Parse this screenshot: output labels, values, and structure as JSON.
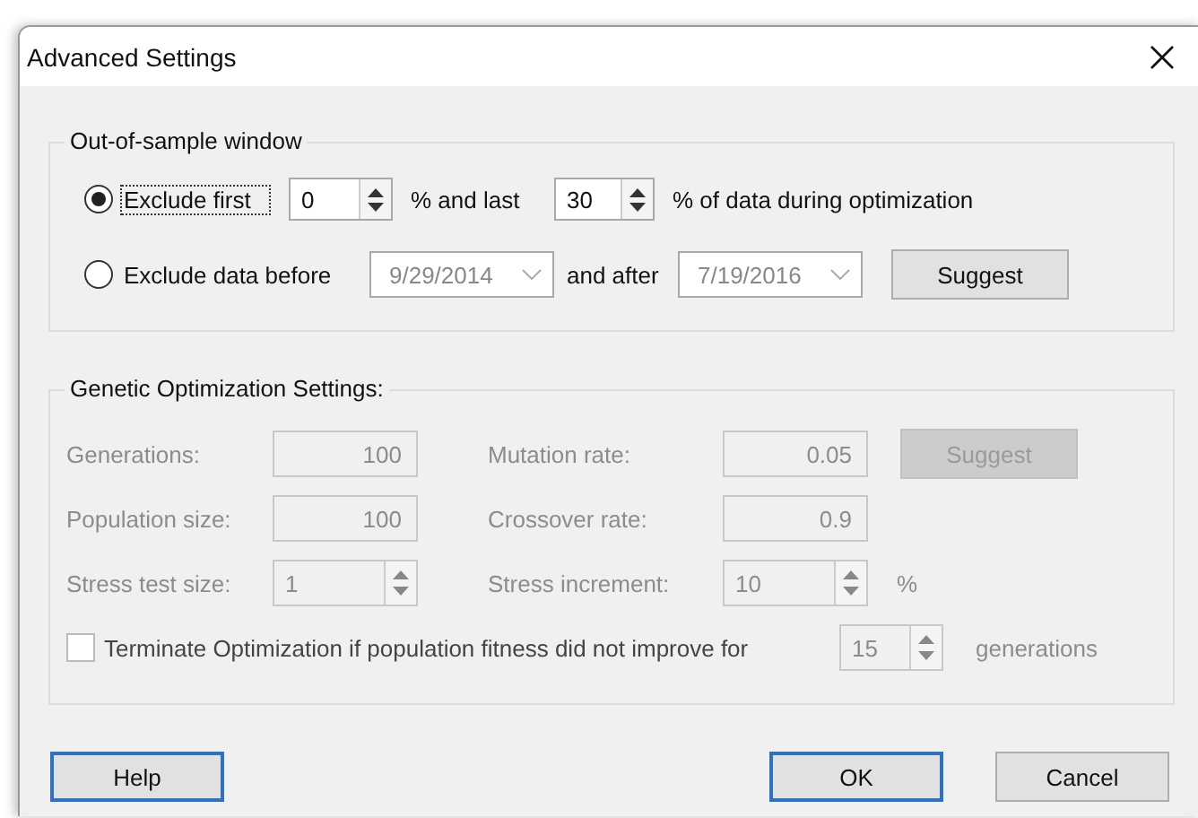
{
  "window": {
    "title": "Advanced Settings"
  },
  "out_of_sample": {
    "legend": "Out-of-sample window",
    "options": [
      {
        "kind": "percent",
        "selected": true,
        "label": "Exclude first",
        "first": "0",
        "middle": "% and last",
        "last": "30",
        "suffix": "% of data during optimization"
      },
      {
        "kind": "dates",
        "selected": false,
        "label": "Exclude data before",
        "before": "9/29/2014",
        "middle": "and after",
        "after": "7/19/2016",
        "button": "Suggest"
      }
    ]
  },
  "genetic": {
    "legend": "Genetic Optimization Settings:",
    "disabled": true,
    "rows": [
      {
        "left": {
          "label": "Generations:",
          "value": "100",
          "kind": "text"
        },
        "right": {
          "label": "Mutation rate:",
          "value": "0.05",
          "kind": "text"
        },
        "extra": {
          "kind": "button",
          "text": "Suggest"
        }
      },
      {
        "left": {
          "label": "Population size:",
          "value": "100",
          "kind": "text"
        },
        "right": {
          "label": "Crossover rate:",
          "value": "0.9",
          "kind": "text"
        }
      },
      {
        "left": {
          "label": "Stress test size:",
          "value": "1",
          "kind": "spin"
        },
        "right": {
          "label": "Stress increment:",
          "value": "10",
          "kind": "spin"
        },
        "extra": {
          "kind": "unit",
          "text": "%"
        }
      }
    ],
    "terminate": {
      "checked": false,
      "label": "Terminate Optimization if population fitness did not improve for",
      "value": "15",
      "suffix": "generations"
    }
  },
  "buttons": [
    {
      "label": "Help",
      "focused": true
    },
    {
      "label": "OK",
      "focused": true
    },
    {
      "label": "Cancel",
      "focused": false
    }
  ]
}
